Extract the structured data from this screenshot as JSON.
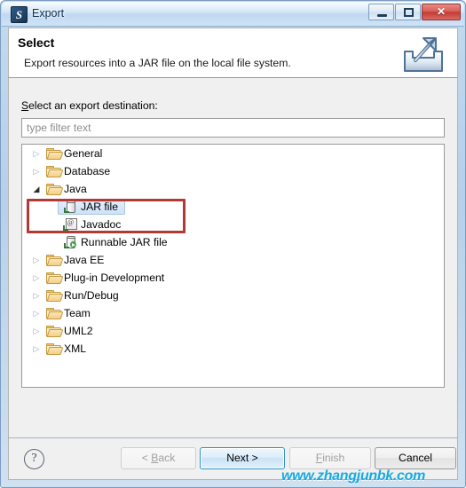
{
  "window": {
    "title": "Export",
    "app_icon": "export-wizard-icon",
    "controls": {
      "minimize": "minimize-button",
      "maximize": "maximize-button",
      "close_label": "✕"
    }
  },
  "header": {
    "title": "Select",
    "description": "Export resources into a JAR file on the local file system.",
    "icon": "export-arrow-tray-icon"
  },
  "main": {
    "destination_label_mnemonic": "S",
    "destination_label_rest": "elect an export destination:",
    "filter": {
      "value": "",
      "placeholder": "type filter text"
    },
    "tree": [
      {
        "label": "General",
        "depth": 0,
        "icon": "folder-icon",
        "twisty": "collapsed",
        "selected": false
      },
      {
        "label": "Database",
        "depth": 0,
        "icon": "folder-icon",
        "twisty": "collapsed",
        "selected": false
      },
      {
        "label": "Java",
        "depth": 0,
        "icon": "folder-icon",
        "twisty": "expanded",
        "selected": false
      },
      {
        "label": "JAR file",
        "depth": 1,
        "icon": "jar-icon",
        "twisty": "none",
        "selected": true
      },
      {
        "label": "Javadoc",
        "depth": 1,
        "icon": "javadoc-icon",
        "twisty": "none",
        "selected": false
      },
      {
        "label": "Runnable JAR file",
        "depth": 1,
        "icon": "runnable-jar-icon",
        "twisty": "none",
        "selected": false
      },
      {
        "label": "Java EE",
        "depth": 0,
        "icon": "folder-icon",
        "twisty": "collapsed",
        "selected": false
      },
      {
        "label": "Plug-in Development",
        "depth": 0,
        "icon": "folder-icon",
        "twisty": "collapsed",
        "selected": false
      },
      {
        "label": "Run/Debug",
        "depth": 0,
        "icon": "folder-icon",
        "twisty": "collapsed",
        "selected": false
      },
      {
        "label": "Team",
        "depth": 0,
        "icon": "folder-icon",
        "twisty": "collapsed",
        "selected": false
      },
      {
        "label": "UML2",
        "depth": 0,
        "icon": "folder-icon",
        "twisty": "collapsed",
        "selected": false
      },
      {
        "label": "XML",
        "depth": 0,
        "icon": "folder-icon",
        "twisty": "collapsed",
        "selected": false
      }
    ],
    "annotation": {
      "type": "red-highlight-rectangle",
      "color": "#b33a34",
      "covers": [
        "Java",
        "JAR file"
      ]
    }
  },
  "footer": {
    "help_glyph": "?",
    "buttons": [
      {
        "name": "back",
        "prefix": "< ",
        "mnemonic": "B",
        "suffix": "ack",
        "state": "disabled"
      },
      {
        "name": "next",
        "prefix": "",
        "mnemonic": "N",
        "suffix": "ext >",
        "state": "default"
      },
      {
        "name": "finish",
        "prefix": "",
        "mnemonic": "F",
        "suffix": "inish",
        "state": "disabled"
      },
      {
        "name": "cancel",
        "prefix": "",
        "mnemonic": "",
        "suffix": "Cancel",
        "state": "normal"
      }
    ]
  },
  "watermark": {
    "text": "www.zhangjunbk.com",
    "color": "#17a9e0"
  }
}
